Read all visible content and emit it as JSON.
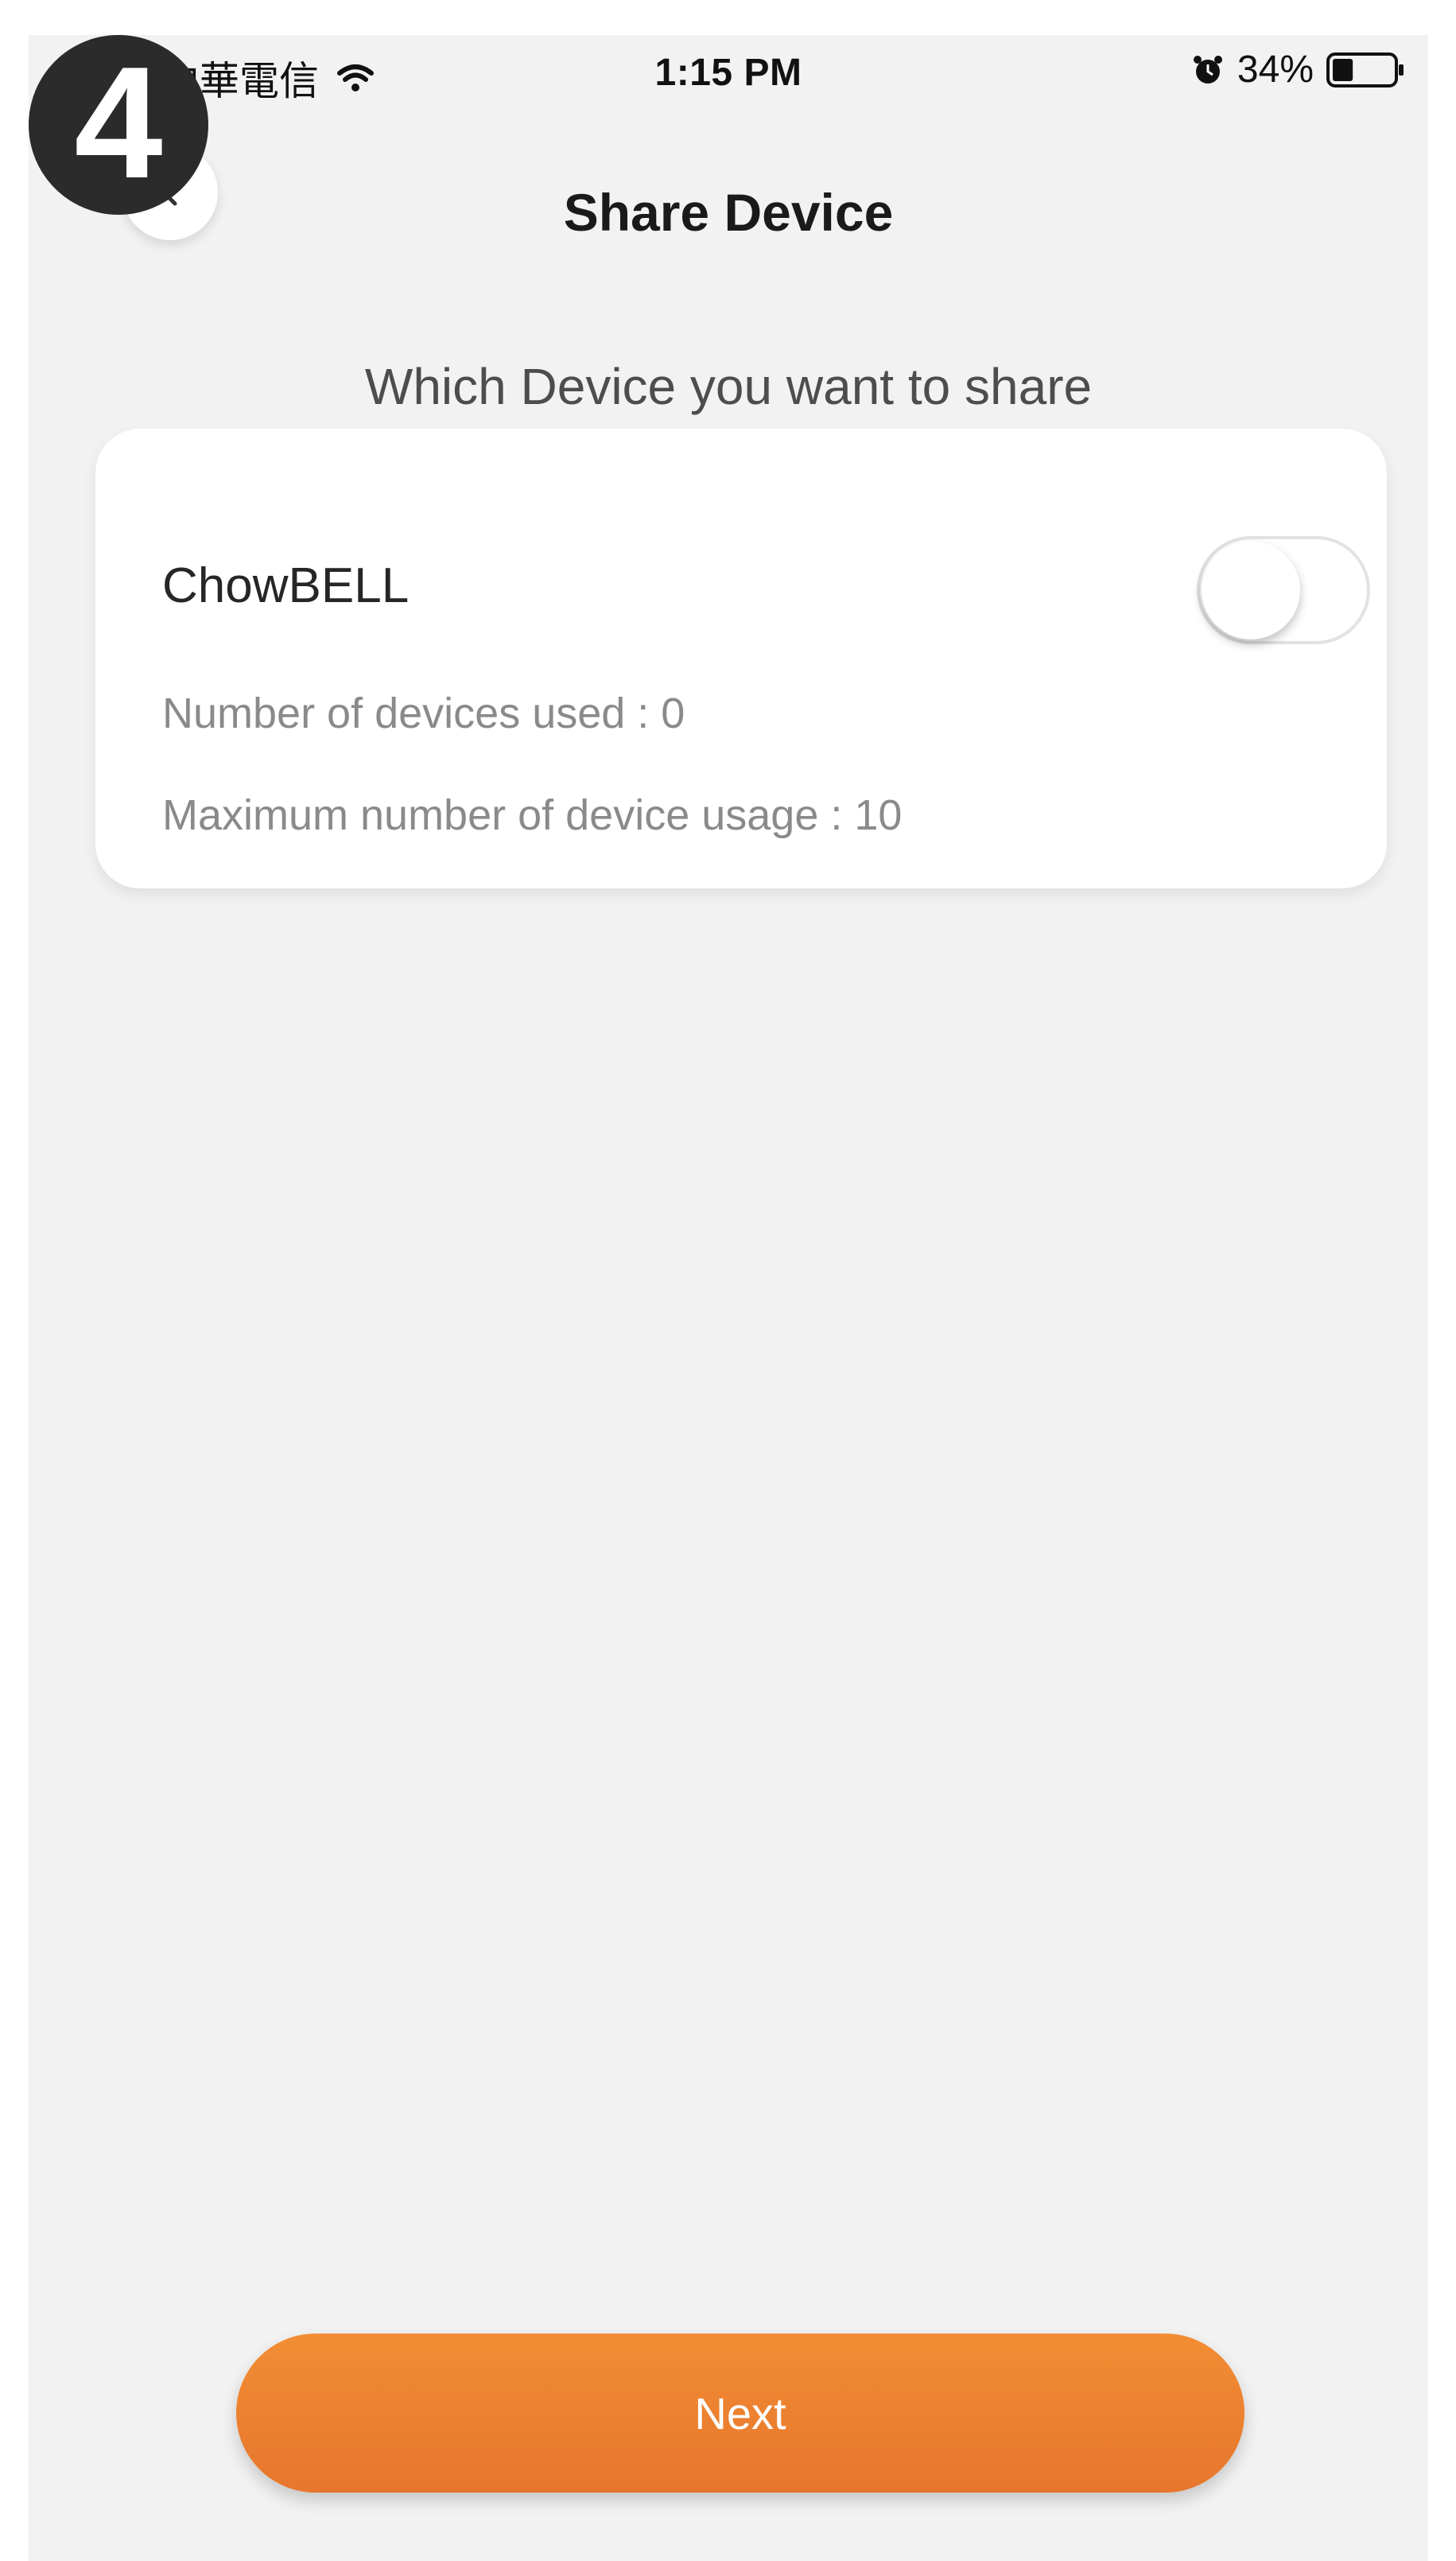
{
  "status_bar": {
    "carrier": "中華電信",
    "time": "1:15 PM",
    "battery_percent": "34%",
    "battery_level": 0.34,
    "icons": [
      "wifi-icon",
      "alarm-icon",
      "battery-icon"
    ]
  },
  "step_badge": {
    "number": "4"
  },
  "header": {
    "title": "Share Device",
    "back_icon": "chevron-left-icon"
  },
  "main": {
    "subtitle": "Which Device you want to share",
    "device": {
      "name": "ChowBELL",
      "used_label": "Number of devices used :  0",
      "max_label": "Maximum number of device usage : 10",
      "shared": false
    }
  },
  "footer": {
    "next_label": "Next"
  },
  "colors": {
    "background": "#f2f2f2",
    "card": "#ffffff",
    "accent": "#f28d34",
    "badge": "#2b2b2b"
  }
}
